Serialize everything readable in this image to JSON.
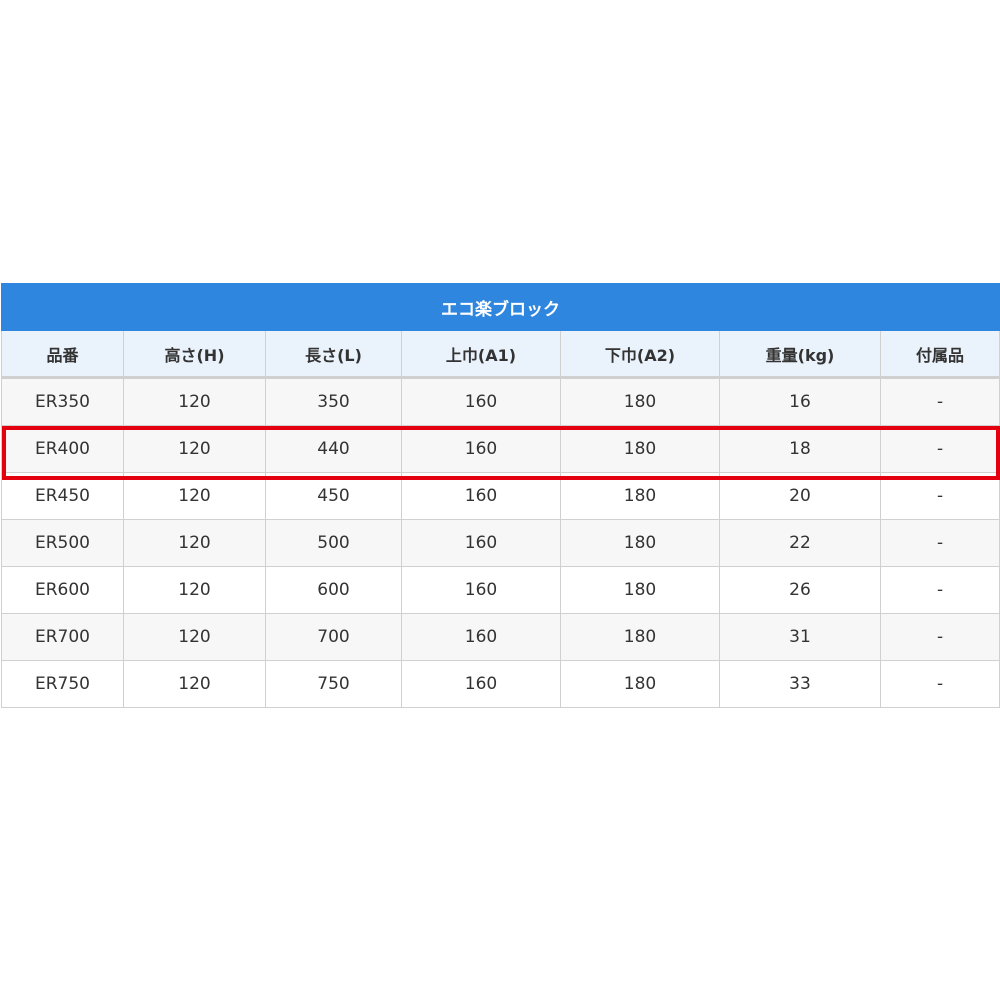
{
  "table": {
    "title": "エコ楽ブロック",
    "headers": [
      "品番",
      "高さ(H)",
      "長さ(L)",
      "上巾(A1)",
      "下巾(A2)",
      "重量(kg)",
      "付属品"
    ],
    "rows": [
      [
        "ER350",
        "120",
        "350",
        "160",
        "180",
        "16",
        "-"
      ],
      [
        "ER400",
        "120",
        "440",
        "160",
        "180",
        "18",
        "-"
      ],
      [
        "ER450",
        "120",
        "450",
        "160",
        "180",
        "20",
        "-"
      ],
      [
        "ER500",
        "120",
        "500",
        "160",
        "180",
        "22",
        "-"
      ],
      [
        "ER600",
        "120",
        "600",
        "160",
        "180",
        "26",
        "-"
      ],
      [
        "ER700",
        "120",
        "700",
        "160",
        "180",
        "31",
        "-"
      ],
      [
        "ER750",
        "120",
        "750",
        "160",
        "180",
        "33",
        "-"
      ]
    ],
    "highlighted_row": "ER400"
  },
  "colors": {
    "title_background": "#2e86de",
    "header_background": "#eaf3fb",
    "highlight_border": "#e3000f"
  }
}
